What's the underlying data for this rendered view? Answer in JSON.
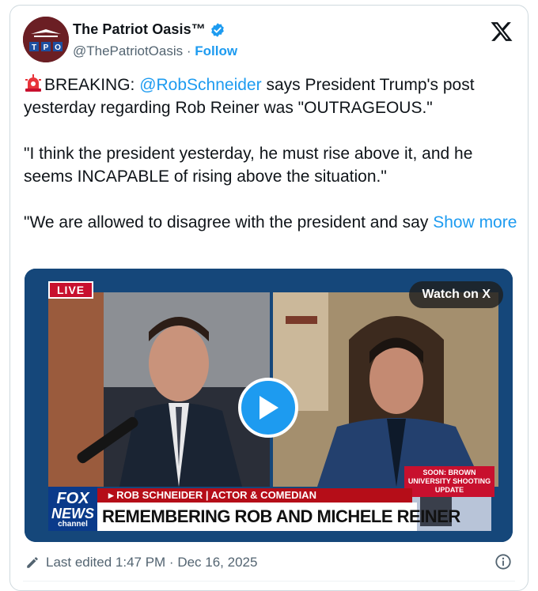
{
  "author": {
    "display_name": "The Patriot Oasis™",
    "handle": "@ThePatriotOasis",
    "separator": "·",
    "follow_label": "Follow",
    "avatar_text": "TPO"
  },
  "tweet": {
    "p1_prefix": "BREAKING: ",
    "p1_mention": "@RobSchneider",
    "p1_rest": " says President Trump's post yesterday regarding Rob Reiner was \"OUTRAGEOUS.\"",
    "p2": "\"I think the president yesterday, he must rise above it, and he seems INCAPABLE of rising above the situation.\"",
    "p3": "\"We are allowed to disagree with the president and say ",
    "show_more": "Show more"
  },
  "media": {
    "watch_label": "Watch on X",
    "live_label": "LIVE",
    "lower_third": "▸ ROB SCHNEIDER | ACTOR & COMEDIAN",
    "headline": "REMEMBERING ROB AND MICHELE REINER",
    "network_line1": "FOX",
    "network_line2": "NEWS",
    "network_line3": "channel",
    "side_banner": "SOON: BROWN UNIVERSITY SHOOTING UPDATE"
  },
  "footer": {
    "edited_text": "Last edited 1:47 PM · Dec 16, 2025"
  },
  "colors": {
    "link": "#1d9bf0",
    "verified": "#1d9bf0",
    "fox_red": "#c8102e"
  }
}
